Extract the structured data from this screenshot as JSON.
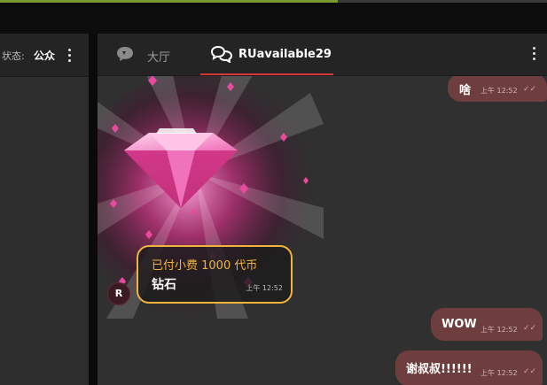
{
  "left_panel": {
    "status_label": "状态:",
    "status_value": "公众"
  },
  "tabs": [
    {
      "label": "大厅",
      "icon": "chat-bubble-icon",
      "active": false
    },
    {
      "label": "RUavailable29",
      "icon": "two-chat-bubbles-icon",
      "active": true
    }
  ],
  "messages": [
    {
      "text": "啥",
      "time": "上午 12:52",
      "status": "read-ticks"
    },
    {
      "text": "WOW",
      "time": "上午 12:52",
      "status": "read-ticks"
    },
    {
      "text": "谢叔叔!!!!!!",
      "time": "上午 12:52",
      "status": "read-ticks"
    }
  ],
  "tip": {
    "title": "已付小费 1000 代币",
    "item": "钻石",
    "time": "上午 12:52",
    "sender_initial": "R"
  },
  "colors": {
    "accent_red": "#d23a3a",
    "tip_gold": "#f0b43c",
    "outgoing_bubble": "#6e3d3d",
    "progress_green": "#7a9a2f"
  }
}
